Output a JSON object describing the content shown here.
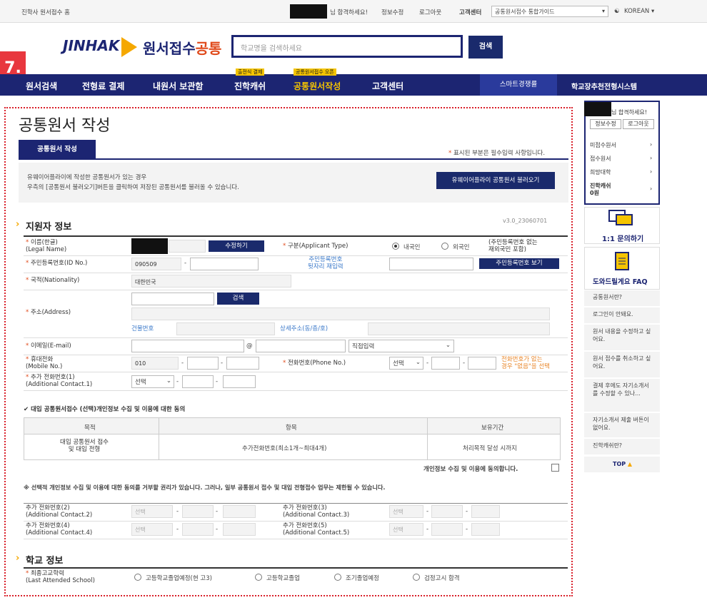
{
  "top": {
    "home": "진학사 원서접수 홈",
    "greeting": "님 합격하세요!",
    "edit_info": "정보수정",
    "logout": "로그아웃",
    "customer_center": "고객센터",
    "guide": "공통원서접수 통합가이드",
    "lang": "KOREAN"
  },
  "header": {
    "logo_brand": "JINHAK",
    "logo_text": "원서접수",
    "logo_text_accent": "공통",
    "search_placeholder": "학교명을 검색하세요",
    "search_button": "검색",
    "step": "7."
  },
  "nav": {
    "items": [
      "원서검색",
      "전형료 결제",
      "내원서 보관함",
      "진학캐쉬",
      "공통원서작성",
      "고객센터"
    ],
    "badge_cash": "출전식 결제",
    "badge_common": "공통원서접수 오픈",
    "smart": "스마트경쟁률",
    "school_rec": "학교장추천전형시스템"
  },
  "page": {
    "title": "공통원서 작성",
    "tab": "공통원서 작성",
    "required_mark": "*",
    "required_note": "표시된 부분은 필수입력 사항입니다.",
    "info_line1": "유웨이어플라이에 작성한 공통원서가 있는 경우",
    "info_line2": "우측의 [공통원서 불러오기]버튼을 클릭하여 저장된 공통원서를 불러올 수 있습니다.",
    "load_button": "유웨이어플라이 공통원서 불러오기",
    "version": "v3.0_23060701",
    "section_applicant": "지원자 정보",
    "section_school": "학교 정보"
  },
  "form": {
    "name_label1": "이름(한글)",
    "name_label2": "(Legal Name)",
    "edit_button": "수정하기",
    "type_label": "구분(Applicant Type)",
    "type_domestic": "내국인",
    "type_foreign": "외국인",
    "type_note1": "(주민등록번호 없는",
    "type_note2": "재외국민 포함)",
    "id_label": "주민등록번호(ID No.)",
    "id_value": "090509",
    "id_reinput1": "주민등록번호",
    "id_reinput2": "뒷자리 재입력",
    "id_view_button": "주민등록번호 보기",
    "nation_label": "국적(Nationality)",
    "nation_value": "대한민국",
    "addr_label": "주소(Address)",
    "addr_search": "검색",
    "building_no": "건물번호",
    "detail_addr": "상세주소(동/층/호)",
    "email_label": "이메일(E-mail)",
    "email_at": "@",
    "email_direct": "직접입력",
    "mobile_label1": "휴대전화",
    "mobile_label2": "(Mobile No.)",
    "mobile_value": "010",
    "phone_label": "전화번호(Phone No.)",
    "select": "선택",
    "phone_note1": "전화번호가 없는",
    "phone_note2": "경우 \"없음\"을 선택",
    "add1_label1": "추가 전화번호(1)",
    "add1_label2": "(Additional Contact.1)",
    "dash": "-"
  },
  "consent": {
    "title": "대입 공통원서접수 (선택)개인정보 수집 및 이용에 대한 동의",
    "headers": [
      "목적",
      "항목",
      "보유기간"
    ],
    "purpose1": "대입 공통원서 접수",
    "purpose2": "및 대입 전형",
    "item": "추가전화번호(최소1개~최대4개)",
    "period": "처리목적 달성 시까지",
    "agree": "개인정보 수집 및 이용에 동의합니다.",
    "notice": "※ 선택적 개인정보 수집 및 이용에 대한 동의를 거부할 권리가 있습니다. 그러나, 일부 공통원서 접수 및 대입 전형접수 업무는 제한될 수 있습니다."
  },
  "extra": {
    "c2a": "추가 전화번호(2)",
    "c2b": "(Additional Contact.2)",
    "c3a": "추가 전화번호(3)",
    "c3b": "(Additional Contact.3)",
    "c4a": "추가 전화번호(4)",
    "c4b": "(Additional Contact.4)",
    "c5a": "추가 전화번호(5)",
    "c5b": "(Additional Contact.5)"
  },
  "school": {
    "label1": "최종고교학력",
    "label2": "(Last Attended School)",
    "opt1": "고등학교졸업예정(현 고3)",
    "opt2": "고등학교졸업",
    "opt3": "조기졸업예정",
    "opt4": "검정고시 합격"
  },
  "sidebar": {
    "greeting": "님 합격하세요!",
    "edit_info": "정보수정",
    "logout": "로그아웃",
    "links": [
      "미접수원서",
      "접수원서",
      "희망대학"
    ],
    "cash_label": "진학캐쉬",
    "cash_value": "0원",
    "inquiry": "1:1 문의하기",
    "faq_title": "도와드릴게요 FAQ",
    "faq": [
      "공통원서란?",
      "로그인이 안돼요.",
      "원서 내용을 수정하고 싶어요.",
      "원서 접수를 취소하고 싶어요.",
      "결제 후에도 자기소개서를 수정할 수 있나...",
      "자기소개서 제출 버튼이 없어요.",
      "진학캐쉬란?"
    ],
    "top": "TOP"
  }
}
